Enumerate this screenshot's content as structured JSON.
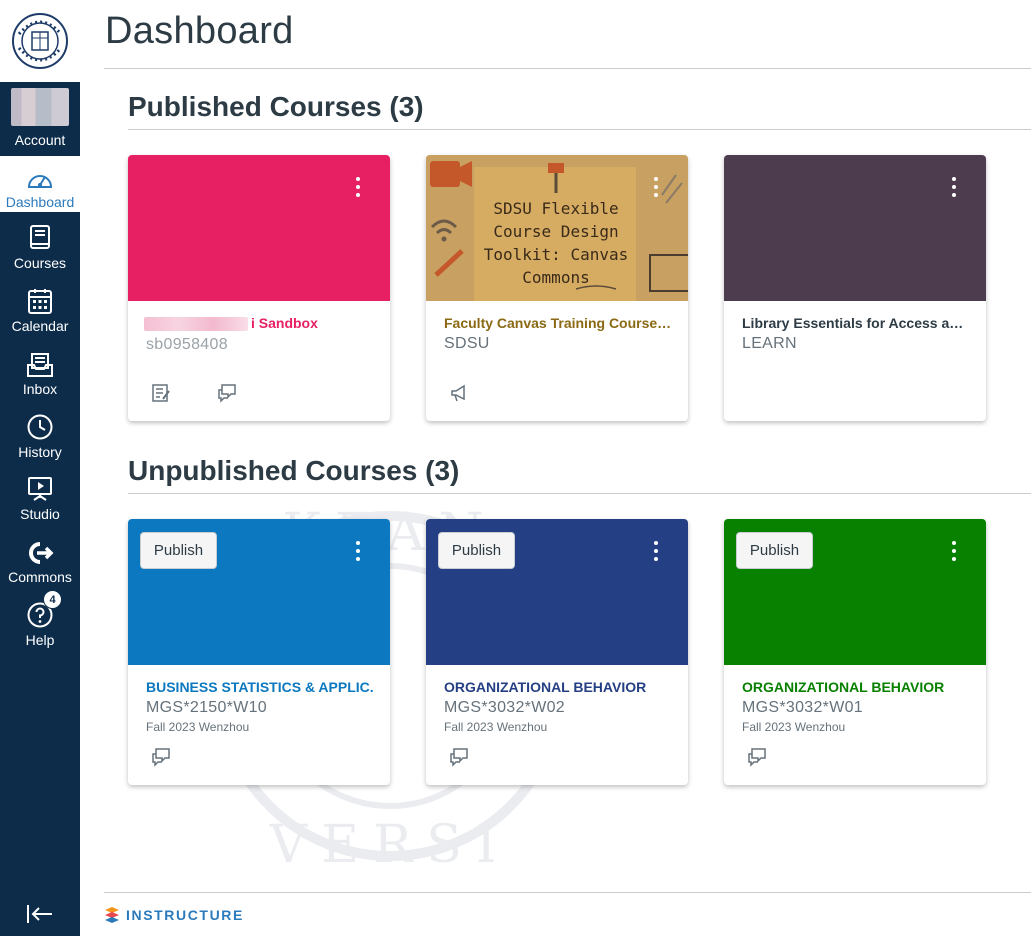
{
  "nav": {
    "account_label": "Account",
    "dashboard_label": "Dashboard",
    "courses_label": "Courses",
    "calendar_label": "Calendar",
    "inbox_label": "Inbox",
    "history_label": "History",
    "studio_label": "Studio",
    "commons_label": "Commons",
    "help_label": "Help",
    "help_badge": "4"
  },
  "page_title": "Dashboard",
  "published": {
    "heading": "Published Courses (3)",
    "cards": [
      {
        "title": "i Sandbox",
        "code": "sb0958408",
        "term": "",
        "color": "#e71f63",
        "title_color": "#e71f63"
      },
      {
        "title": "Faculty Canvas Training Course [fr…",
        "code": "SDSU",
        "term": "",
        "color": "#c49a4b",
        "title_color": "#8b6914",
        "hero_text": "SDSU Flexible Course Design Toolkit: Canvas Commons"
      },
      {
        "title": "Library Essentials for Access and R…",
        "code": "LEARN",
        "term": "",
        "color": "#4d3b4e",
        "title_color": "#2d3b45"
      }
    ]
  },
  "unpublished": {
    "heading": "Unpublished Courses (3)",
    "publish_label": "Publish",
    "cards": [
      {
        "title": "BUSINESS STATISTICS & APPLIC.",
        "code": "MGS*2150*W10",
        "term": "Fall 2023 Wenzhou",
        "color": "#0b78bf",
        "title_color": "#0b78bf"
      },
      {
        "title": "ORGANIZATIONAL BEHAVIOR",
        "code": "MGS*3032*W02",
        "term": "Fall 2023 Wenzhou",
        "color": "#253f85",
        "title_color": "#253f85"
      },
      {
        "title": "ORGANIZATIONAL BEHAVIOR",
        "code": "MGS*3032*W01",
        "term": "Fall 2023 Wenzhou",
        "color": "#088000",
        "title_color": "#088000"
      }
    ]
  },
  "footer": {
    "brand": "INSTRUCTURE"
  },
  "colors": {
    "nav_bg": "#0d2c4a",
    "accent": "#2b7abc"
  }
}
